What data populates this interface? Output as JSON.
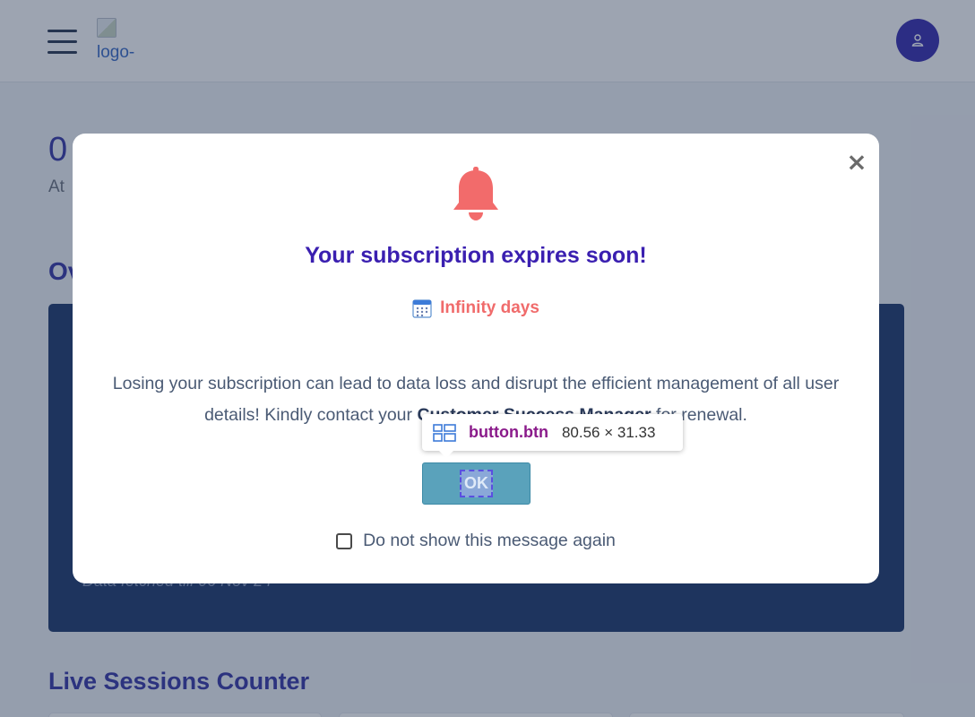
{
  "header": {
    "logo_alt": "logo-"
  },
  "dashboard": {
    "big_number": "0",
    "sub_text": "At",
    "overview_title": "Ov",
    "fetched_text": "Data fetched till 06 Nov 24",
    "live_sessions_title": "Live Sessions Counter"
  },
  "modal": {
    "title": "Your subscription expires soon!",
    "days_text": "Infinity days",
    "message_before": "Losing your subscription can lead to data loss and disrupt the efficient management of all user details! Kindly contact your ",
    "message_strong": "Customer Success Manager",
    "message_after": " for renewal.",
    "ok_label": "OK",
    "checkbox_label": "Do not show this message again",
    "close_symbol": "×"
  },
  "inspector_tooltip": {
    "selector_tag": "button",
    "selector_class": ".btn",
    "size": "80.56 × 31.33"
  },
  "colors": {
    "accent": "#3a1fb0",
    "bell": "#f26b6b",
    "ok_button": "#5aa2bb",
    "dark_card": "#213b6e"
  }
}
